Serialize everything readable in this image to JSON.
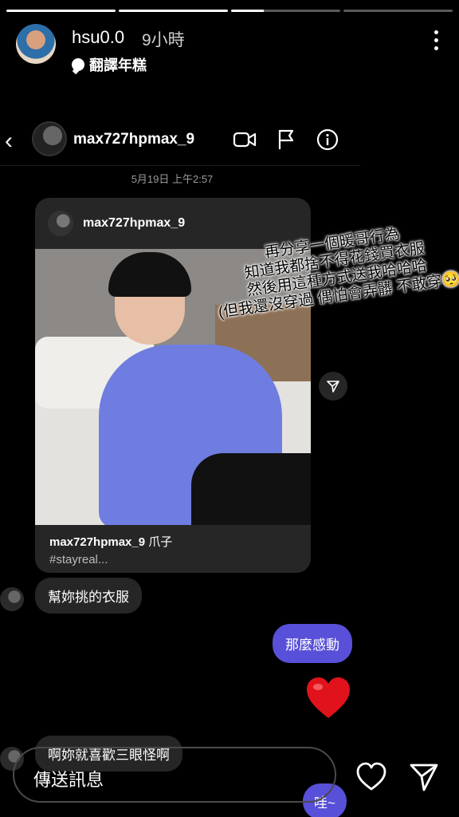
{
  "story": {
    "progress": [
      1,
      1,
      0.3,
      0
    ],
    "username": "hsu0.0",
    "time": "9小時",
    "subtitle": "翻譯年糕"
  },
  "dm": {
    "username": "max727hpmax_9",
    "timestamp": "5月19日 上午2:57",
    "post": {
      "user": "max727hpmax_9",
      "caption_user": "max727hpmax_9",
      "caption_text": "爪子",
      "caption_tags": "#stayreal..."
    },
    "overlay_lines": [
      "再分享一個暖哥行為",
      "知道我都捨不得花錢買衣服",
      "然後用這種方式送我哈哈哈",
      "(但我還沒穿過 偶怕會弄髒 不敢穿🥺"
    ],
    "messages": [
      {
        "dir": "in",
        "text": "幫妳挑的衣服"
      },
      {
        "dir": "out",
        "text": "那麼感動"
      },
      {
        "dir": "in",
        "text": "啊妳就喜歡三眼怪啊"
      },
      {
        "dir": "out",
        "text": "哇~"
      }
    ],
    "composer_placeholder": "傳送訊息"
  },
  "colors": {
    "accent": "#5850d8",
    "incoming_bubble": "#262626",
    "background": "#000000"
  }
}
